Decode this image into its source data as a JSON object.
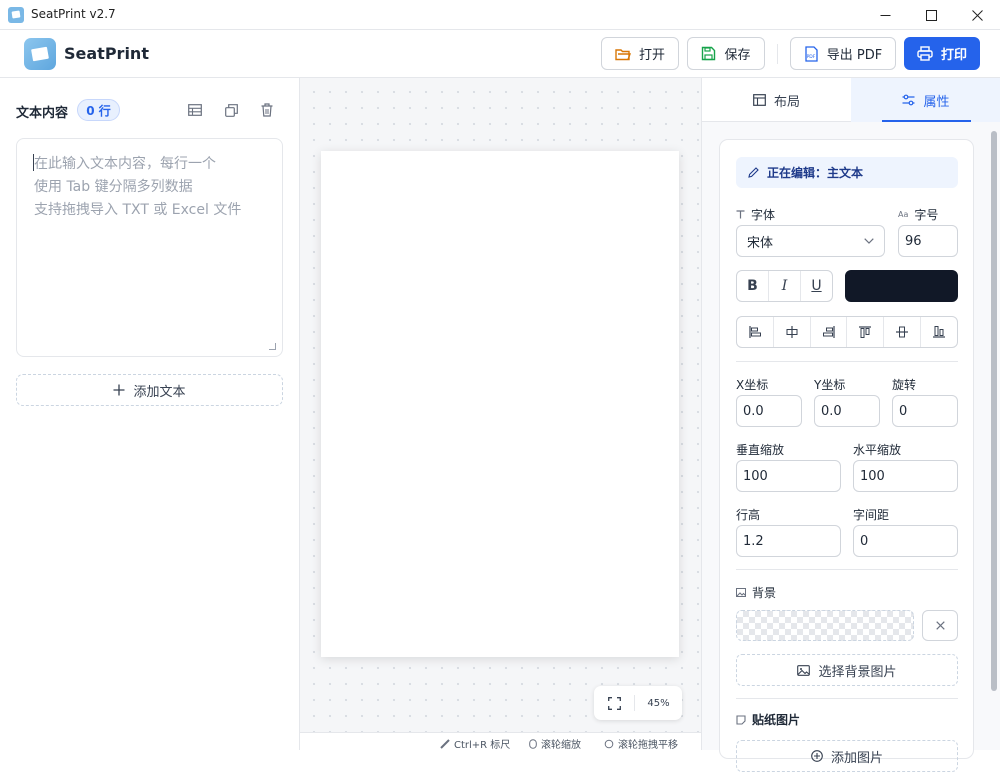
{
  "window": {
    "title": "SeatPrint v2.7",
    "minimize": "—",
    "maximize": "☐",
    "close": "✕"
  },
  "header": {
    "brand": "SeatPrint",
    "open_label": "打开",
    "save_label": "保存",
    "export_label": "导出 PDF",
    "print_label": "打印",
    "accent": "#2563eb"
  },
  "left": {
    "title": "文本内容",
    "row_count": "0 行",
    "placeholder_lines": [
      "在此输入文本内容，每行一个",
      "使用 Tab 键分隔多列数据",
      "支持拖拽导入 TXT 或 Excel 文件"
    ],
    "add_text_label": "添加文本"
  },
  "canvas": {
    "zoom": "45%"
  },
  "status": {
    "ruler": "Ctrl+R 标尺",
    "wheel_zoom": "滚轮缩放",
    "wheel_pan": "滚轮拖拽平移"
  },
  "right": {
    "tabs": {
      "layout": "布局",
      "properties": "属性"
    },
    "active_tab": "属性",
    "editing": "正在编辑：主文本",
    "font_label": "字体",
    "font_value": "宋体",
    "size_label": "字号",
    "size_value": "96",
    "style_buttons": [
      "B",
      "I",
      "U"
    ],
    "text_color": "#111827",
    "x_label": "X坐标",
    "x_value": "0.0",
    "y_label": "Y坐标",
    "y_value": "0.0",
    "rotate_label": "旋转",
    "rotate_value": "0",
    "vscale_label": "垂直缩放",
    "vscale_value": "100",
    "hscale_label": "水平缩放",
    "hscale_value": "100",
    "lineheight_label": "行高",
    "lineheight_value": "1.2",
    "spacing_label": "字间距",
    "spacing_value": "0",
    "background_label": "背景",
    "select_bg_label": "选择背景图片",
    "sticker_label": "贴纸图片",
    "add_sticker_label": "添加图片"
  }
}
